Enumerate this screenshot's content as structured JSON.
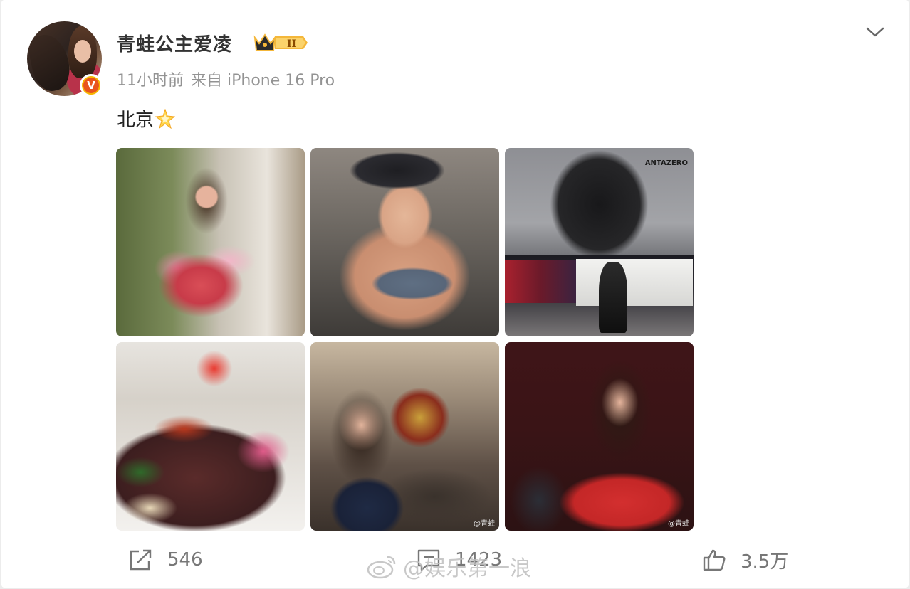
{
  "post": {
    "username": "青蛙公主爱凌",
    "vip_level": "II",
    "time": "11小时前",
    "source": "来自 iPhone 16 Pro",
    "text": "北京",
    "text_emoji": "star-sparkle-icon"
  },
  "photos": [
    {
      "name": "photo-flowers"
    },
    {
      "name": "photo-selfie-gym"
    },
    {
      "name": "photo-billboard-street",
      "caption": "ANTAZERO"
    },
    {
      "name": "photo-dinner-table"
    },
    {
      "name": "photo-theater",
      "watermark": "@青蛙"
    },
    {
      "name": "photo-red-jacket",
      "watermark": "@青蛙"
    }
  ],
  "actions": {
    "repost_count": "546",
    "comment_count": "1423",
    "like_count": "3.5万"
  },
  "overlay_watermark": "@娱乐第一浪",
  "colors": {
    "text_primary": "#333333",
    "text_secondary": "#939393",
    "verified_badge": "#f7b500",
    "vip_gold": "#f4b73a"
  }
}
